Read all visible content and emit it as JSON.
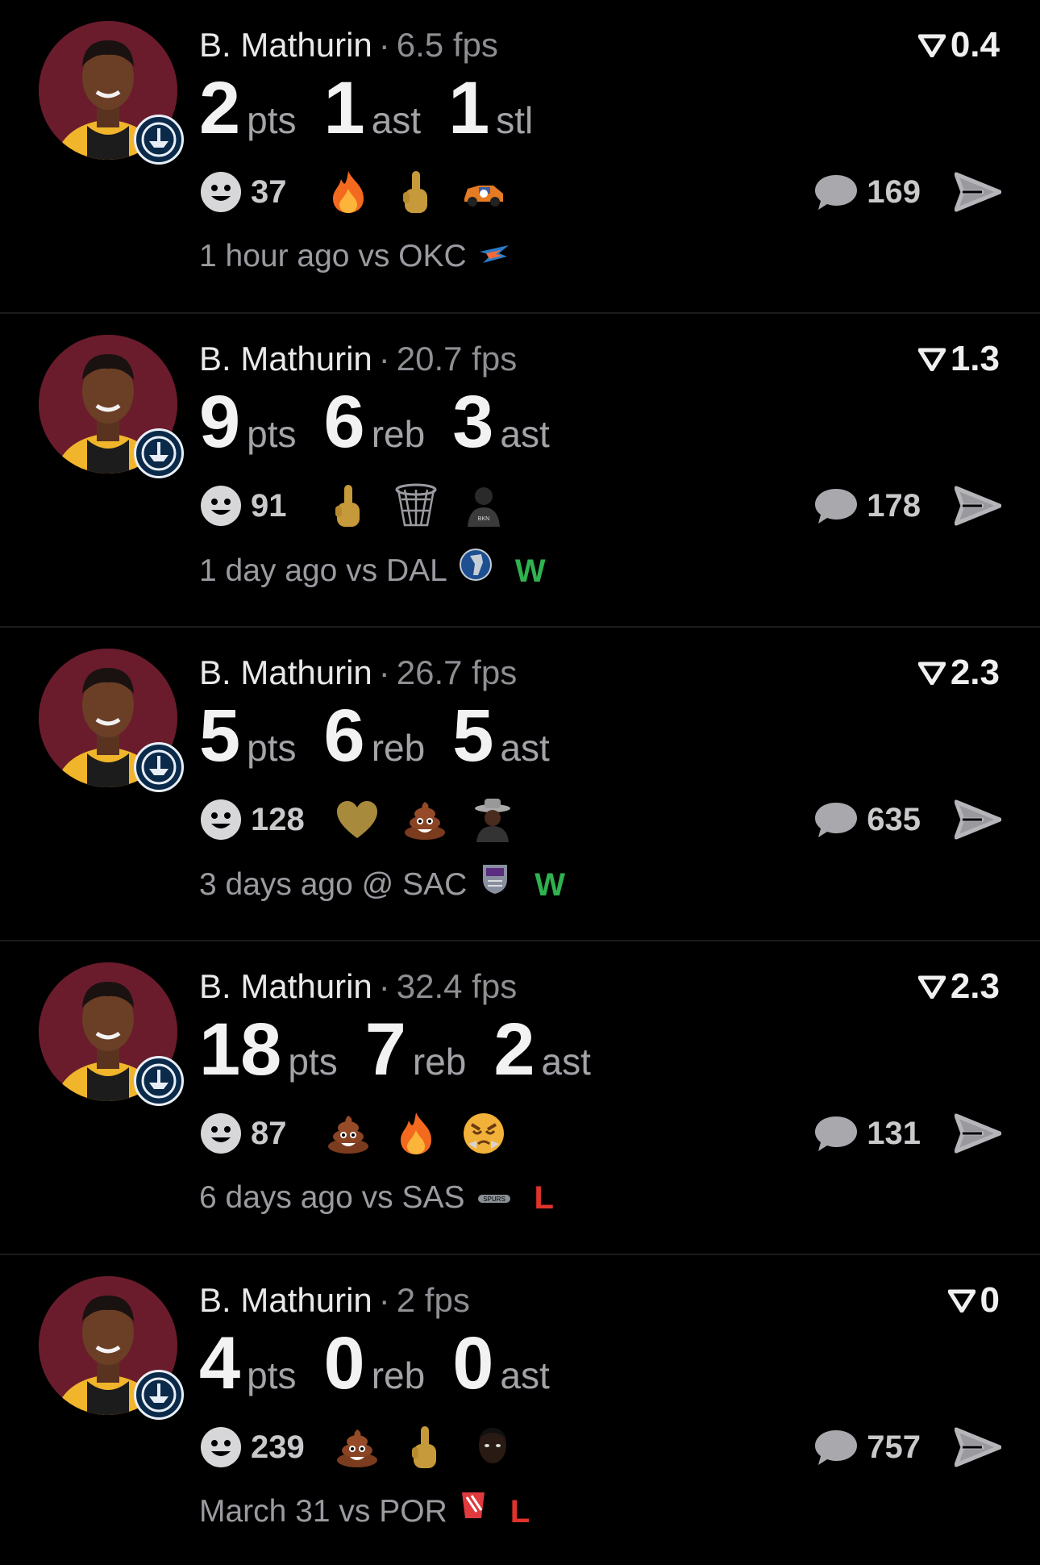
{
  "colors": {
    "background": "#000000",
    "avatar_bg": "#6a1c2c",
    "win": "#2fb24f",
    "loss": "#e0332c",
    "secondary_text": "#9a9aa0"
  },
  "cards": [
    {
      "player": "B. Mathurin",
      "fps": "6.5 fps",
      "score": "0.4",
      "stats": [
        {
          "num": "2",
          "label": "pts"
        },
        {
          "num": "1",
          "label": "ast"
        },
        {
          "num": "1",
          "label": "stl"
        }
      ],
      "reaction_count": "37",
      "reactions": [
        "fire-emoji",
        "middle-finger-emoji",
        "race-car-emoji"
      ],
      "comments": "169",
      "meta_text": "1 hour ago vs OKC",
      "team_icon": "okc-logo-icon",
      "result": ""
    },
    {
      "player": "B. Mathurin",
      "fps": "20.7 fps",
      "score": "1.3",
      "stats": [
        {
          "num": "9",
          "label": "pts"
        },
        {
          "num": "6",
          "label": "reb"
        },
        {
          "num": "3",
          "label": "ast"
        }
      ],
      "reaction_count": "91",
      "reactions": [
        "middle-finger-emoji",
        "basketball-net-emoji",
        "brooklyn-player-emoji"
      ],
      "comments": "178",
      "meta_text": "1 day ago vs DAL",
      "team_icon": "dal-logo-icon",
      "result": "W"
    },
    {
      "player": "B. Mathurin",
      "fps": "26.7 fps",
      "score": "2.3",
      "stats": [
        {
          "num": "5",
          "label": "pts"
        },
        {
          "num": "6",
          "label": "reb"
        },
        {
          "num": "5",
          "label": "ast"
        }
      ],
      "reaction_count": "128",
      "reactions": [
        "gold-heart-emoji",
        "poop-emoji",
        "cowboy-hat-person-emoji"
      ],
      "comments": "635",
      "meta_text": "3 days ago @ SAC",
      "team_icon": "sac-logo-icon",
      "result": "W"
    },
    {
      "player": "B. Mathurin",
      "fps": "32.4 fps",
      "score": "2.3",
      "stats": [
        {
          "num": "18",
          "label": "pts"
        },
        {
          "num": "7",
          "label": "reb"
        },
        {
          "num": "2",
          "label": "ast"
        }
      ],
      "reaction_count": "87",
      "reactions": [
        "poop-emoji",
        "fire-emoji",
        "angry-face-emoji"
      ],
      "comments": "131",
      "meta_text": "6 days ago vs SAS",
      "team_icon": "sas-logo-icon",
      "result": "L"
    },
    {
      "player": "B. Mathurin",
      "fps": "2 fps",
      "score": "0",
      "stats": [
        {
          "num": "4",
          "label": "pts"
        },
        {
          "num": "0",
          "label": "reb"
        },
        {
          "num": "0",
          "label": "ast"
        }
      ],
      "reaction_count": "239",
      "reactions": [
        "poop-emoji",
        "middle-finger-emoji",
        "dark-face-emoji"
      ],
      "comments": "757",
      "meta_text": "March 31 vs POR",
      "team_icon": "por-logo-icon",
      "result": "L"
    }
  ]
}
